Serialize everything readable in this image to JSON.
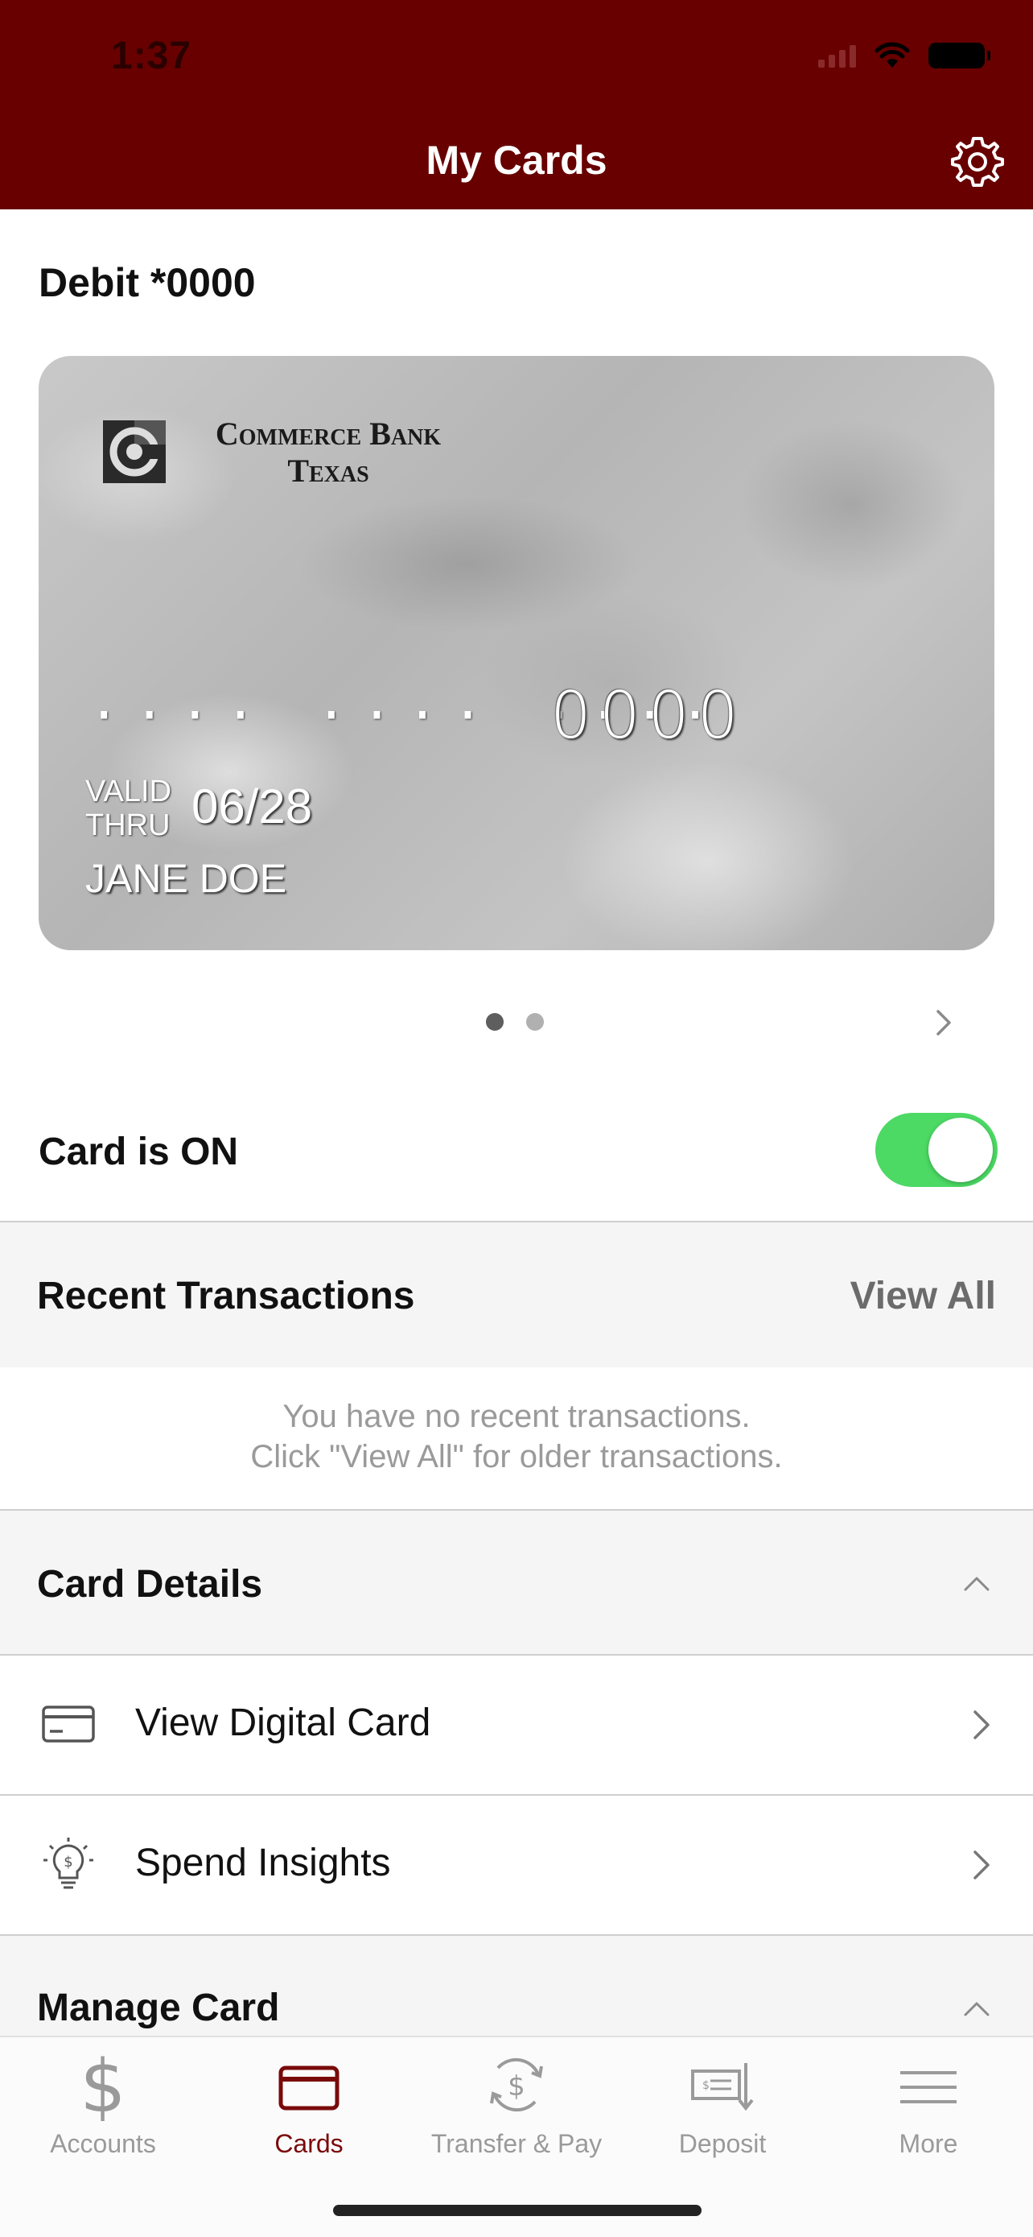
{
  "status_bar": {
    "time": "1:37"
  },
  "header": {
    "title": "My Cards"
  },
  "card": {
    "title": "Debit *0000",
    "bank_name_line1": "Commerce Bank",
    "bank_name_line2": "Texas",
    "masked_groups": "···· ···· ····",
    "last4": "0000",
    "valid_thru_label": "VALID THRU",
    "expiry": "06/28",
    "holder": "JANE DOE",
    "pager_total": 2,
    "pager_active": 1
  },
  "card_status": {
    "label": "Card is ON",
    "on": true
  },
  "recent_transactions": {
    "title": "Recent Transactions",
    "view_all": "View All",
    "empty_line1": "You have no recent transactions.",
    "empty_line2": "Click \"View All\" for older transactions."
  },
  "card_details": {
    "title": "Card Details",
    "items": [
      {
        "label": "View Digital Card",
        "icon": "credit-card-icon"
      },
      {
        "label": "Spend Insights",
        "icon": "lightbulb-dollar-icon"
      }
    ]
  },
  "manage_card": {
    "title": "Manage Card"
  },
  "tabbar": {
    "tabs": [
      {
        "label": "Accounts",
        "icon": "dollar-icon",
        "active": false
      },
      {
        "label": "Cards",
        "icon": "card-icon",
        "active": true
      },
      {
        "label": "Transfer & Pay",
        "icon": "transfer-icon",
        "active": false
      },
      {
        "label": "Deposit",
        "icon": "deposit-check-icon",
        "active": false
      },
      {
        "label": "More",
        "icon": "menu-icon",
        "active": false
      }
    ]
  },
  "colors": {
    "header_bg": "#680000",
    "toggle_on": "#4cd964",
    "active_tab": "#7a0a0a"
  }
}
